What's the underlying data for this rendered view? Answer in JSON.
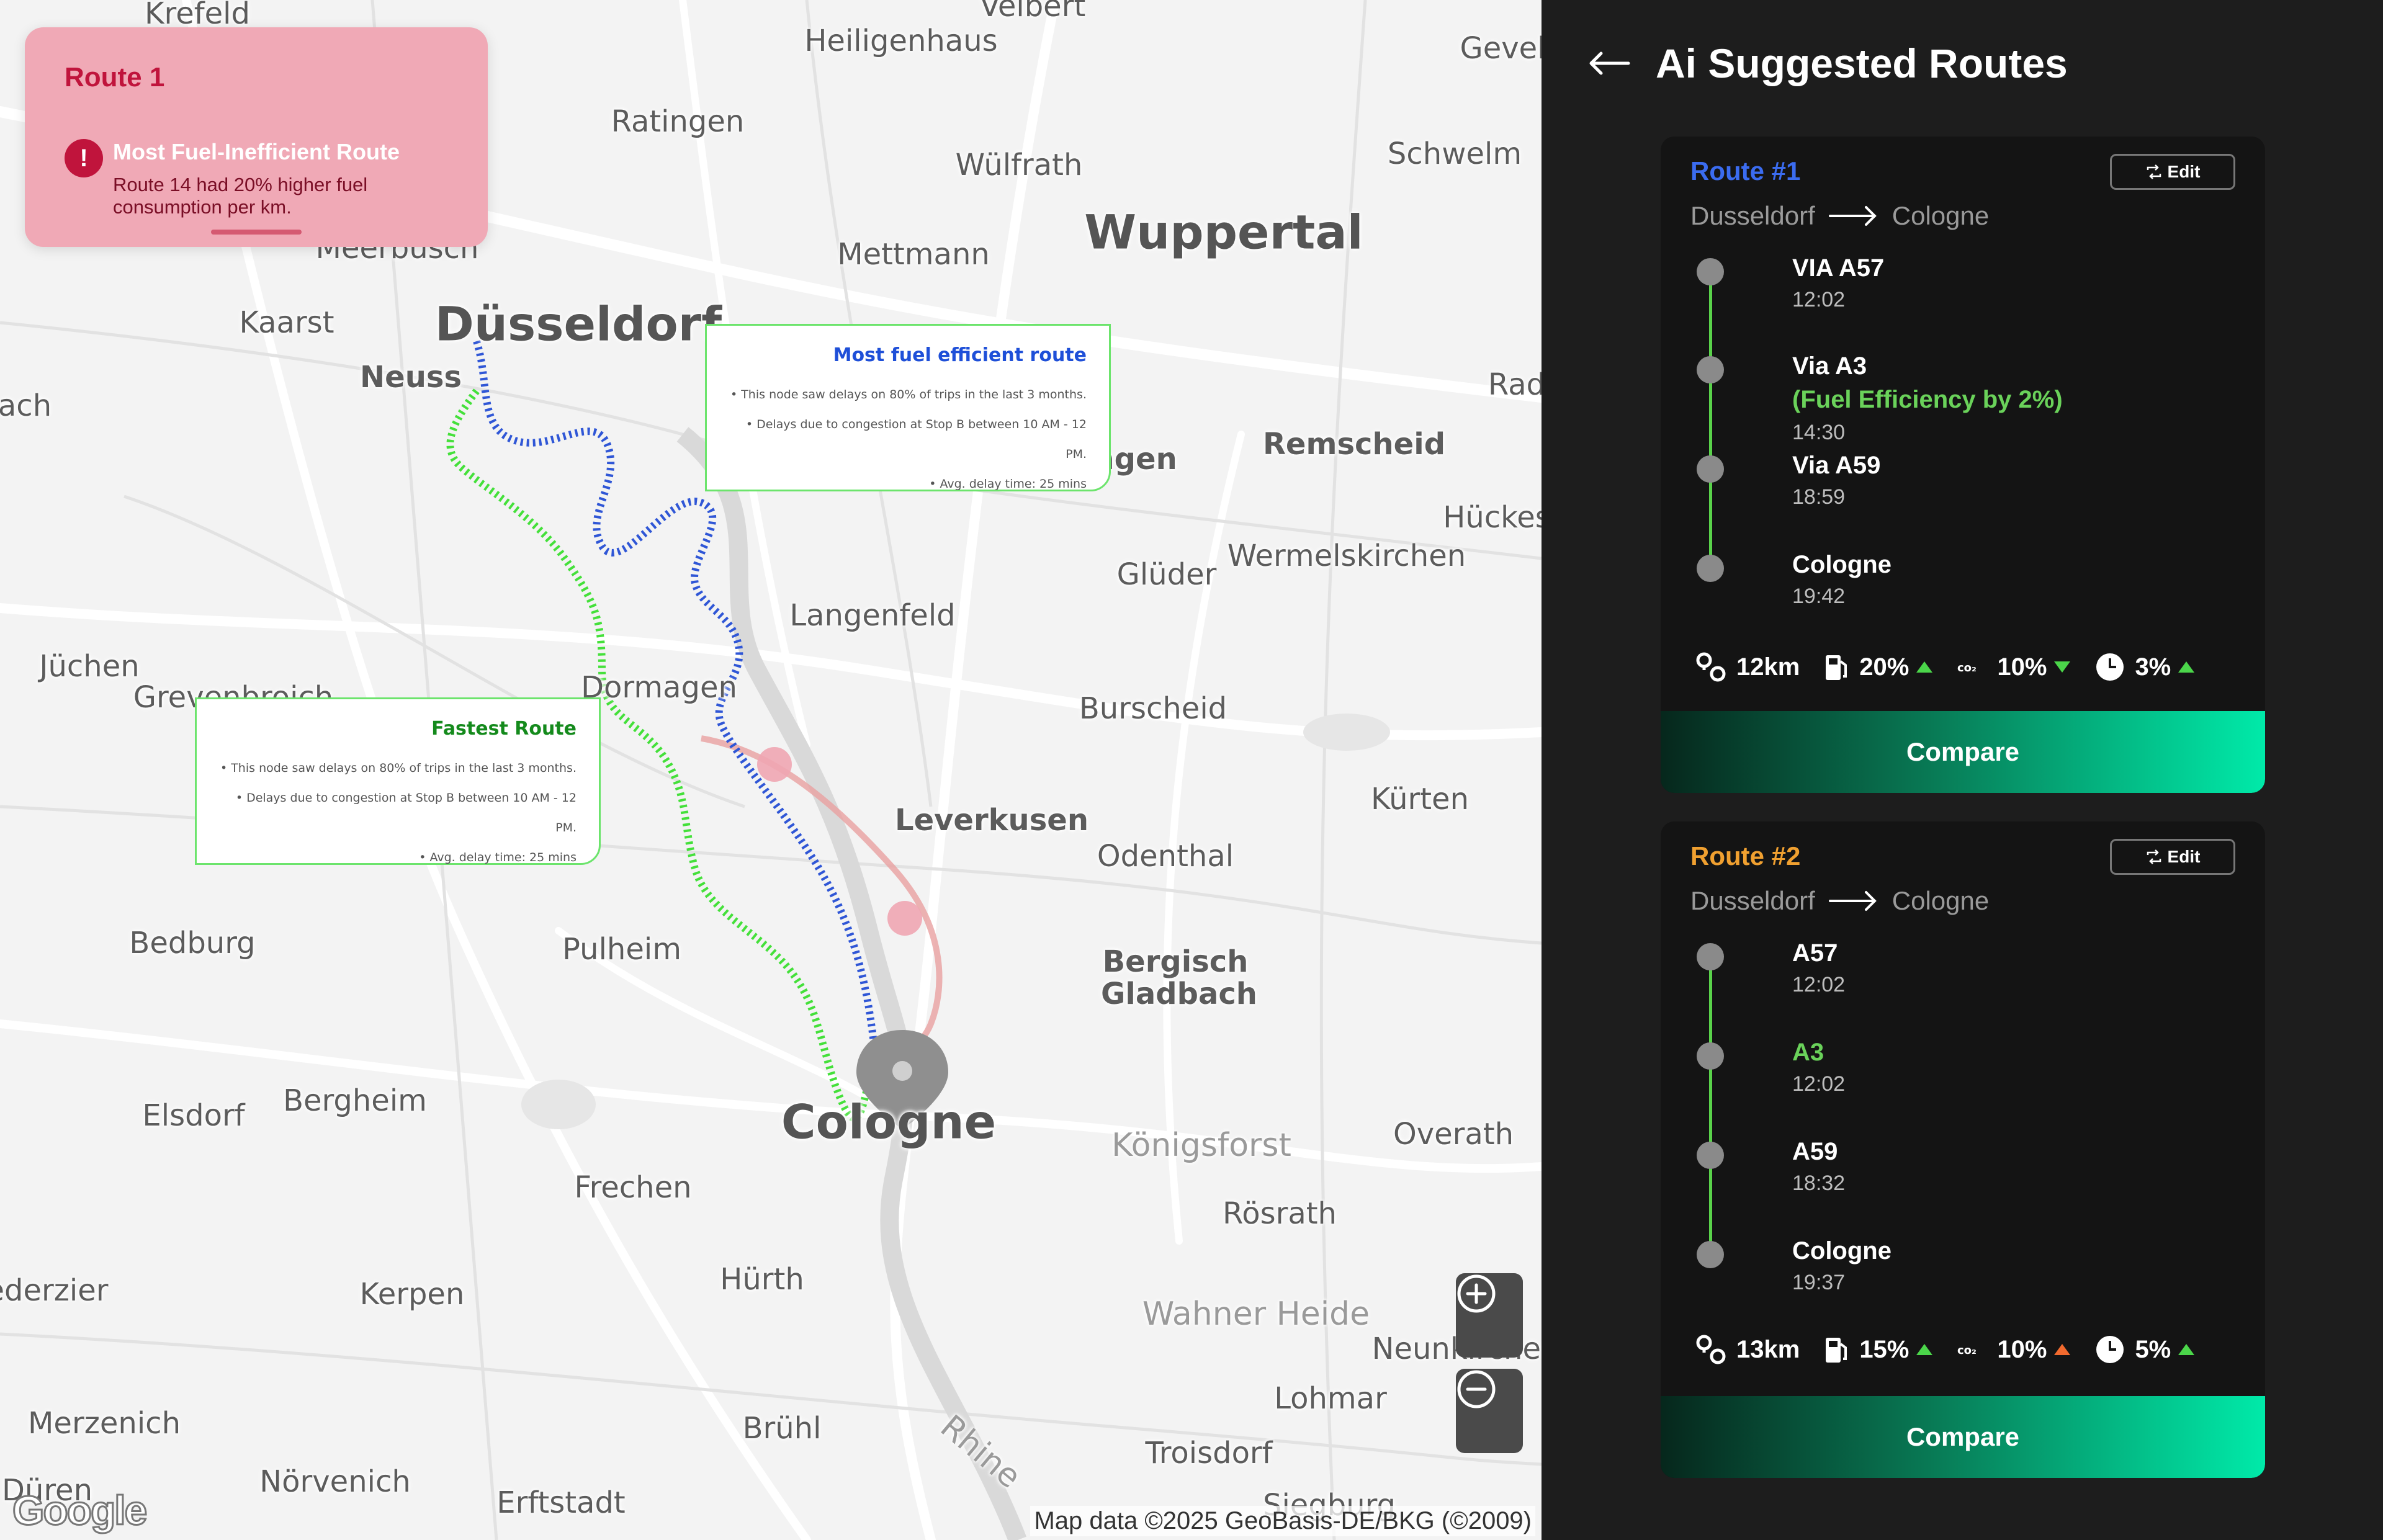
{
  "map": {
    "places": [
      {
        "name": "Krefeld",
        "size": "m"
      },
      {
        "name": "Velbert",
        "size": "m"
      },
      {
        "name": "Heiligenhaus",
        "size": "m"
      },
      {
        "name": "Gevels",
        "size": "m"
      },
      {
        "name": "Ratingen",
        "size": "m"
      },
      {
        "name": "Wülfrath",
        "size": "m"
      },
      {
        "name": "Schwelm",
        "size": "m"
      },
      {
        "name": "Meerbusch",
        "size": "m"
      },
      {
        "name": "Mettmann",
        "size": "m"
      },
      {
        "name": "Wuppertal",
        "size": "l"
      },
      {
        "name": "Kaarst",
        "size": "m"
      },
      {
        "name": "Düsseldorf",
        "size": "l"
      },
      {
        "name": "Neuss",
        "size": "m"
      },
      {
        "name": "ach",
        "size": "m"
      },
      {
        "name": "Rad",
        "size": "m"
      },
      {
        "name": "Remscheid",
        "size": "m"
      },
      {
        "name": "agen",
        "size": "m"
      },
      {
        "name": "Hückes",
        "size": "m"
      },
      {
        "name": "Glüder",
        "size": "m"
      },
      {
        "name": "Wermelskirchen",
        "size": "m"
      },
      {
        "name": "Langenfeld",
        "size": "m"
      },
      {
        "name": "Jüchen",
        "size": "m"
      },
      {
        "name": "Grevenbroich",
        "size": "m"
      },
      {
        "name": "Dormagen",
        "size": "m"
      },
      {
        "name": "Burscheid",
        "size": "m"
      },
      {
        "name": "Leverkusen",
        "size": "m"
      },
      {
        "name": "Kürten",
        "size": "m"
      },
      {
        "name": "Odenthal",
        "size": "m"
      },
      {
        "name": "Bedburg",
        "size": "m"
      },
      {
        "name": "Pulheim",
        "size": "m"
      },
      {
        "name": "Bergisch Gladbach",
        "size": "m"
      },
      {
        "name": "Elsdorf",
        "size": "m"
      },
      {
        "name": "Bergheim",
        "size": "m"
      },
      {
        "name": "Cologne",
        "size": "l"
      },
      {
        "name": "Königsforst",
        "size": "lt"
      },
      {
        "name": "Overath",
        "size": "m"
      },
      {
        "name": "Frechen",
        "size": "m"
      },
      {
        "name": "Rösrath",
        "size": "m"
      },
      {
        "name": "ederzier",
        "size": "m"
      },
      {
        "name": "Kerpen",
        "size": "m"
      },
      {
        "name": "Hürth",
        "size": "m"
      },
      {
        "name": "Wahner Heide",
        "size": "lt"
      },
      {
        "name": "Neunkirchen",
        "size": "m"
      },
      {
        "name": "Lohmar",
        "size": "m"
      },
      {
        "name": "Merzenich",
        "size": "m"
      },
      {
        "name": "Brühl",
        "size": "m"
      },
      {
        "name": "Rhine",
        "size": "lt"
      },
      {
        "name": "Troisdorf",
        "size": "m"
      },
      {
        "name": "Düren",
        "size": "m"
      },
      {
        "name": "Nörvenich",
        "size": "m"
      },
      {
        "name": "Erftstadt",
        "size": "m"
      },
      {
        "name": "Siegburg",
        "size": "m"
      }
    ],
    "alert": {
      "title": "Route 1",
      "icon": "exclamation-icon",
      "headline": "Most Fuel-Inefficient Route",
      "description": "Route 14 had 20% higher fuel consumption per km."
    },
    "fuel_card": {
      "title": "Most fuel efficient route",
      "color": "#1e4fd8",
      "bullets": [
        "This node saw delays on 80% of trips in the last 3 months.",
        "Delays due to congestion at Stop B between 10 AM - 12 PM.",
        "Avg. delay time: 25 mins"
      ]
    },
    "fast_card": {
      "title": "Fastest Route",
      "color": "#148a1c",
      "bullets": [
        "This node saw delays on 80% of trips in the last 3 months.",
        "Delays due to congestion at Stop B between 10 AM - 12 PM.",
        "Avg. delay time: 25 mins"
      ]
    },
    "copyright": "Map data ©2025 GeoBasis-DE/BKG (©2009)",
    "logo": "Google",
    "route_colors": {
      "fuel_efficient": "#2f56d6",
      "fastest": "#44e03a",
      "inefficient": "#e89a9a"
    }
  },
  "panel": {
    "title": "Ai Suggested Routes",
    "routes": [
      {
        "title": "Route #1",
        "title_color": "#3b6cf0",
        "edit_label": "Edit",
        "from": "Dusseldorf",
        "to": "Cologne",
        "stops": [
          {
            "name": "VIA A57",
            "time": "12:02"
          },
          {
            "name": "Via A3",
            "note": "(Fuel Efficiency by 2%)",
            "time": "14:30"
          },
          {
            "name": "Via A59",
            "time": "18:59"
          },
          {
            "name": "Cologne",
            "time": "19:42"
          }
        ],
        "stats": {
          "distance": "12km",
          "fuel": "20%",
          "fuel_trend": "up",
          "co2": "10%",
          "co2_trend": "down",
          "time": "3%",
          "time_trend": "up"
        },
        "compare_label": "Compare"
      },
      {
        "title": "Route #2",
        "title_color": "#f0a030",
        "edit_label": "Edit",
        "from": "Dusseldorf",
        "to": "Cologne",
        "stops": [
          {
            "name": "A57",
            "time": "12:02"
          },
          {
            "name": "A3",
            "time": "12:02",
            "highlight": true
          },
          {
            "name": "A59",
            "time": "18:32"
          },
          {
            "name": "Cologne",
            "time": "19:37"
          }
        ],
        "stats": {
          "distance": "13km",
          "fuel": "15%",
          "fuel_trend": "up",
          "co2": "10%",
          "co2_trend": "up-orange",
          "time": "5%",
          "time_trend": "up"
        },
        "compare_label": "Compare"
      }
    ]
  }
}
